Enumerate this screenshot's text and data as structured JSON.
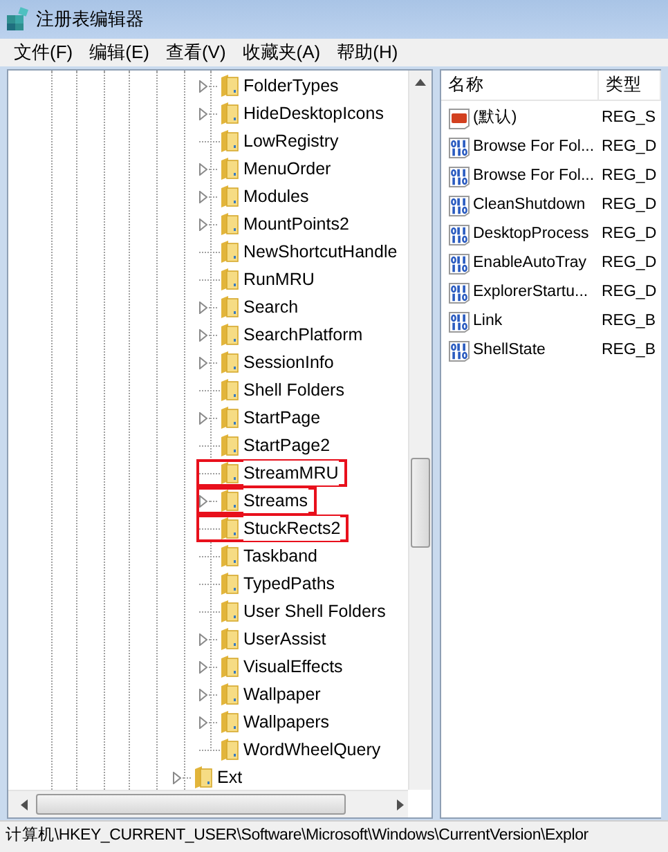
{
  "window": {
    "title": "注册表编辑器"
  },
  "menu": [
    "文件(F)",
    "编辑(E)",
    "查看(V)",
    "收藏夹(A)",
    "帮助(H)"
  ],
  "tree": {
    "items": [
      {
        "label": "FolderTypes",
        "expandable": true,
        "highlighted": false
      },
      {
        "label": "HideDesktopIcons",
        "expandable": true,
        "highlighted": false
      },
      {
        "label": "LowRegistry",
        "expandable": false,
        "highlighted": false
      },
      {
        "label": "MenuOrder",
        "expandable": true,
        "highlighted": false
      },
      {
        "label": "Modules",
        "expandable": true,
        "highlighted": false
      },
      {
        "label": "MountPoints2",
        "expandable": true,
        "highlighted": false
      },
      {
        "label": "NewShortcutHandle",
        "expandable": false,
        "highlighted": false
      },
      {
        "label": "RunMRU",
        "expandable": false,
        "highlighted": false
      },
      {
        "label": "Search",
        "expandable": true,
        "highlighted": false
      },
      {
        "label": "SearchPlatform",
        "expandable": true,
        "highlighted": false
      },
      {
        "label": "SessionInfo",
        "expandable": true,
        "highlighted": false
      },
      {
        "label": "Shell Folders",
        "expandable": false,
        "highlighted": false
      },
      {
        "label": "StartPage",
        "expandable": true,
        "highlighted": false
      },
      {
        "label": "StartPage2",
        "expandable": false,
        "highlighted": false
      },
      {
        "label": "StreamMRU",
        "expandable": false,
        "highlighted": true
      },
      {
        "label": "Streams",
        "expandable": true,
        "highlighted": true
      },
      {
        "label": "StuckRects2",
        "expandable": false,
        "highlighted": true
      },
      {
        "label": "Taskband",
        "expandable": false,
        "highlighted": false
      },
      {
        "label": "TypedPaths",
        "expandable": false,
        "highlighted": false
      },
      {
        "label": "User Shell Folders",
        "expandable": false,
        "highlighted": false
      },
      {
        "label": "UserAssist",
        "expandable": true,
        "highlighted": false
      },
      {
        "label": "VisualEffects",
        "expandable": true,
        "highlighted": false
      },
      {
        "label": "Wallpaper",
        "expandable": true,
        "highlighted": false
      },
      {
        "label": "Wallpapers",
        "expandable": true,
        "highlighted": false
      },
      {
        "label": "WordWheelQuery",
        "expandable": false,
        "highlighted": false
      }
    ],
    "parent_level_items": [
      {
        "label": "Ext",
        "expandable": true,
        "highlighted": false
      }
    ]
  },
  "values": {
    "columns": [
      "名称",
      "类型"
    ],
    "rows": [
      {
        "kind": "string",
        "name": "(默认)",
        "type": "REG_S"
      },
      {
        "kind": "binary",
        "name": "Browse For Fol...",
        "type": "REG_D"
      },
      {
        "kind": "binary",
        "name": "Browse For Fol...",
        "type": "REG_D"
      },
      {
        "kind": "binary",
        "name": "CleanShutdown",
        "type": "REG_D"
      },
      {
        "kind": "binary",
        "name": "DesktopProcess",
        "type": "REG_D"
      },
      {
        "kind": "binary",
        "name": "EnableAutoTray",
        "type": "REG_D"
      },
      {
        "kind": "binary",
        "name": "ExplorerStartu...",
        "type": "REG_D"
      },
      {
        "kind": "binary",
        "name": "Link",
        "type": "REG_B"
      },
      {
        "kind": "binary",
        "name": "ShellState",
        "type": "REG_B"
      }
    ]
  },
  "status_bar": "计算机\\HKEY_CURRENT_USER\\Software\\Microsoft\\Windows\\CurrentVersion\\Explor"
}
